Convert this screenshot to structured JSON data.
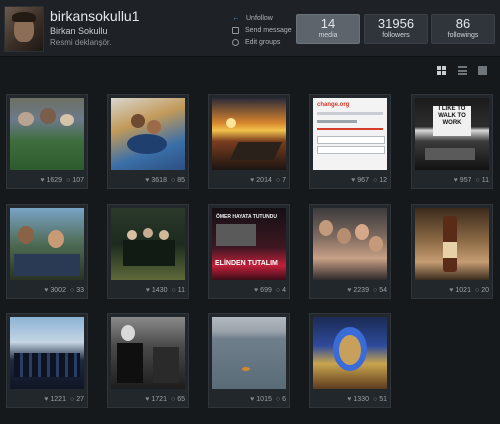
{
  "profile": {
    "username": "birkansokullu1",
    "full_name": "Birkan Sokullu",
    "bio": "Resmi deklanşör."
  },
  "actions": [
    {
      "label": "Unfollow",
      "icon": "arrow-left-icon"
    },
    {
      "label": "Send message",
      "icon": "message-icon"
    },
    {
      "label": "Edit groups",
      "icon": "groups-icon"
    }
  ],
  "stats": [
    {
      "value": "14",
      "label": "media",
      "active": true
    },
    {
      "value": "31956",
      "label": "followers",
      "active": false
    },
    {
      "value": "86",
      "label": "followings",
      "active": false
    }
  ],
  "view_modes": [
    "grid-view-icon",
    "list-view-icon",
    "large-view-icon"
  ],
  "photos": [
    {
      "likes": "1629",
      "comments": "107"
    },
    {
      "likes": "3618",
      "comments": "85"
    },
    {
      "likes": "2014",
      "comments": "7"
    },
    {
      "likes": "967",
      "comments": "12"
    },
    {
      "likes": "957",
      "comments": "11"
    },
    {
      "likes": "3002",
      "comments": "33"
    },
    {
      "likes": "1430",
      "comments": "11"
    },
    {
      "likes": "699",
      "comments": "4"
    },
    {
      "likes": "2239",
      "comments": "54"
    },
    {
      "likes": "1021",
      "comments": "20"
    },
    {
      "likes": "1221",
      "comments": "27"
    },
    {
      "likes": "1721",
      "comments": "65"
    },
    {
      "likes": "1015",
      "comments": "6"
    },
    {
      "likes": "1330",
      "comments": "51"
    }
  ],
  "thumb_text": {
    "petition_site": "change.org",
    "sign_text": "I LIKE TO WALK TO WORK",
    "poster_top": "ÖMER HAYATA TUTUNDU",
    "poster_bottom": "ELİNDEN TUTALIM"
  },
  "colors": {
    "background": "#16191c",
    "header": "#1e2226",
    "accent": "#5aa7e6",
    "stat_active": "#5d646b"
  }
}
